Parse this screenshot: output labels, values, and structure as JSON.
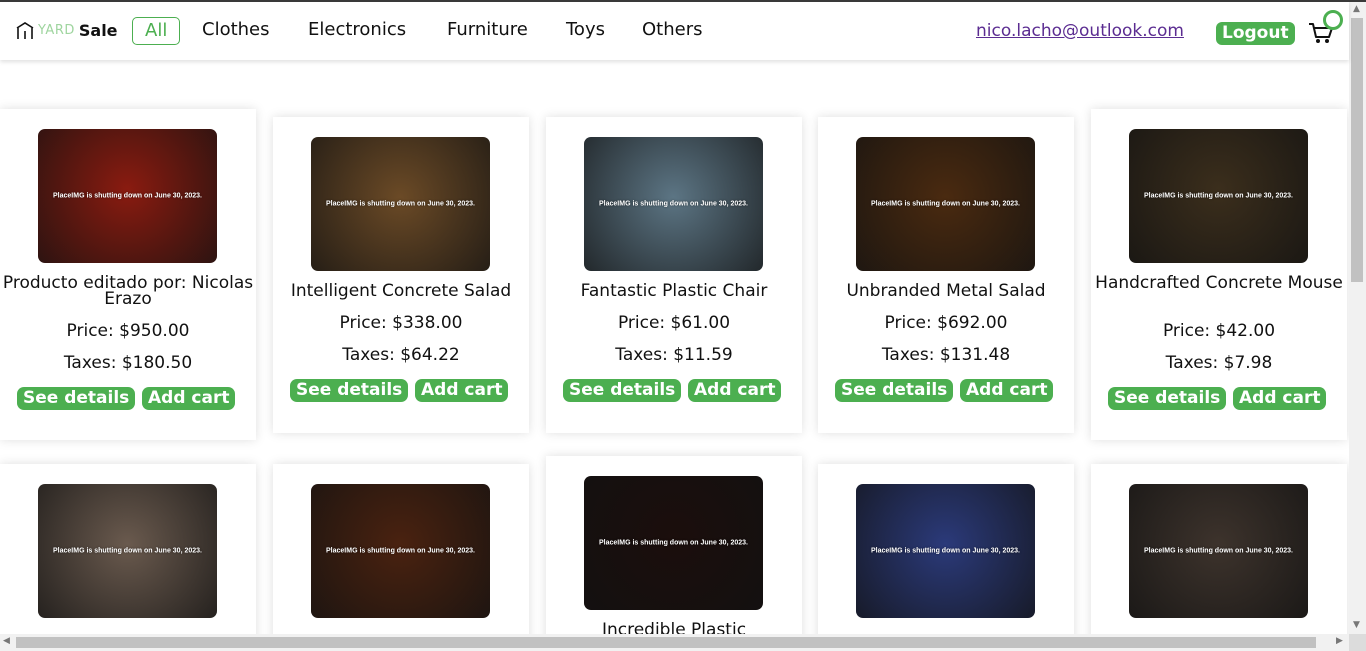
{
  "brand": {
    "yard": "YARD",
    "sale": "Sale"
  },
  "nav": {
    "items": [
      {
        "label": "All",
        "active": true
      },
      {
        "label": "Clothes",
        "active": false
      },
      {
        "label": "Electronics",
        "active": false
      },
      {
        "label": "Furniture",
        "active": false
      },
      {
        "label": "Toys",
        "active": false
      },
      {
        "label": "Others",
        "active": false
      }
    ]
  },
  "user": {
    "email": "nico.lacho@outlook.com",
    "logout_label": "Logout"
  },
  "cart": {
    "icon": "cart-icon",
    "badge_color": "#4caf50"
  },
  "placeholder_text": "PlaceIMG is shutting down on June 30, 2023.",
  "buttons": {
    "details": "See details",
    "add": "Add cart"
  },
  "accent_color": "#4caf50",
  "products": [
    {
      "title": "Producto editado por: Nicolas Erazo",
      "price": "Price: $950.00",
      "taxes": "Taxes: $180.50",
      "image_color": "#8a1b10"
    },
    {
      "title": "Intelligent Concrete Salad",
      "price": "Price: $338.00",
      "taxes": "Taxes: $64.22",
      "image_color": "#6b4a26"
    },
    {
      "title": "Fantastic Plastic Chair",
      "price": "Price: $61.00",
      "taxes": "Taxes: $11.59",
      "image_color": "#5c7584"
    },
    {
      "title": "Unbranded Metal Salad",
      "price": "Price: $692.00",
      "taxes": "Taxes: $131.48",
      "image_color": "#4a2a10"
    },
    {
      "title": "Handcrafted Concrete Mouse",
      "price": "Price: $42.00",
      "taxes": "Taxes: $7.98",
      "image_color": "#3b2e1c"
    },
    {
      "title": "",
      "price": "",
      "taxes": "",
      "image_color": "#6a5a4e"
    },
    {
      "title": "",
      "price": "",
      "taxes": "",
      "image_color": "#4a2210"
    },
    {
      "title": "Incredible Plastic",
      "price": "",
      "taxes": "",
      "image_color": "#1b0e0c"
    },
    {
      "title": "",
      "price": "",
      "taxes": "",
      "image_color": "#2b3a7a"
    },
    {
      "title": "",
      "price": "",
      "taxes": "",
      "image_color": "#3d332c"
    }
  ]
}
